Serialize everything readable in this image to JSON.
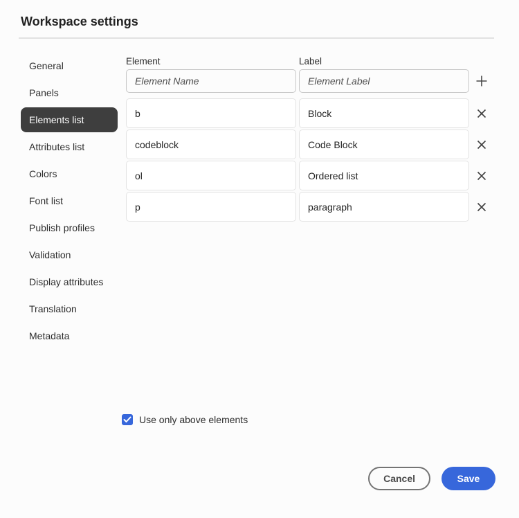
{
  "dialog": {
    "title": "Workspace settings"
  },
  "colors": {
    "accent": "#3767db",
    "sidebar_selected_bg": "#3e3e3e",
    "divider": "#e2e2e2"
  },
  "sidebar": {
    "items": [
      {
        "label": "General",
        "selected": false
      },
      {
        "label": "Panels",
        "selected": false
      },
      {
        "label": "Elements list",
        "selected": true
      },
      {
        "label": "Attributes list",
        "selected": false
      },
      {
        "label": "Colors",
        "selected": false
      },
      {
        "label": "Font list",
        "selected": false
      },
      {
        "label": "Publish profiles",
        "selected": false
      },
      {
        "label": "Validation",
        "selected": false
      },
      {
        "label": "Display attributes",
        "selected": false
      },
      {
        "label": "Translation",
        "selected": false
      },
      {
        "label": "Metadata",
        "selected": false
      }
    ]
  },
  "elements_panel": {
    "columns": {
      "element": "Element",
      "label": "Label"
    },
    "new_entry": {
      "element_placeholder": "Element Name",
      "label_placeholder": "Element Label",
      "add_icon": "plus-icon"
    },
    "rows": [
      {
        "element": "b",
        "label": "Block"
      },
      {
        "element": "codeblock",
        "label": "Code Block"
      },
      {
        "element": "ol",
        "label": "Ordered list"
      },
      {
        "element": "p",
        "label": "paragraph"
      }
    ],
    "remove_icon": "close-icon"
  },
  "options": {
    "use_only_above": {
      "label": "Use only above elements",
      "checked": true,
      "check_icon": "checkmark-icon"
    }
  },
  "footer": {
    "cancel_label": "Cancel",
    "save_label": "Save"
  }
}
